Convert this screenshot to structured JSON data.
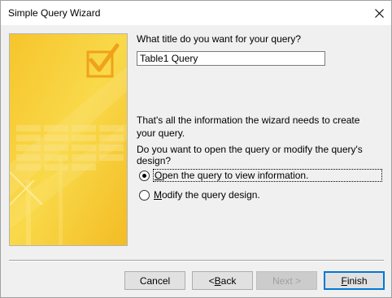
{
  "window": {
    "title": "Simple Query Wizard",
    "close_icon": "close-icon"
  },
  "content": {
    "title_question": "What title do you want for your query?",
    "query_title_value": "Table1 Query",
    "info_text": "That's all the information the wizard needs to create your query.",
    "open_or_modify_question": "Do you want to open the query or modify the query's design?",
    "options": [
      {
        "label": "Open the query to view information.",
        "accelerator": "O",
        "rest": "pen the query to view information.",
        "selected": true
      },
      {
        "label": "Modify the query design.",
        "accelerator": "M",
        "rest": "odify the query design.",
        "selected": false
      }
    ]
  },
  "buttons": {
    "cancel": "Cancel",
    "back": {
      "label": "< Back",
      "prefix": "< ",
      "accelerator": "B",
      "rest": "ack"
    },
    "next": "Next >",
    "finish": {
      "label": "Finish",
      "accelerator": "F",
      "rest": "inish"
    }
  },
  "colors": {
    "art_yellow": "#f7d23c",
    "art_orange": "#f2b21f",
    "focus_blue": "#0078d7"
  }
}
